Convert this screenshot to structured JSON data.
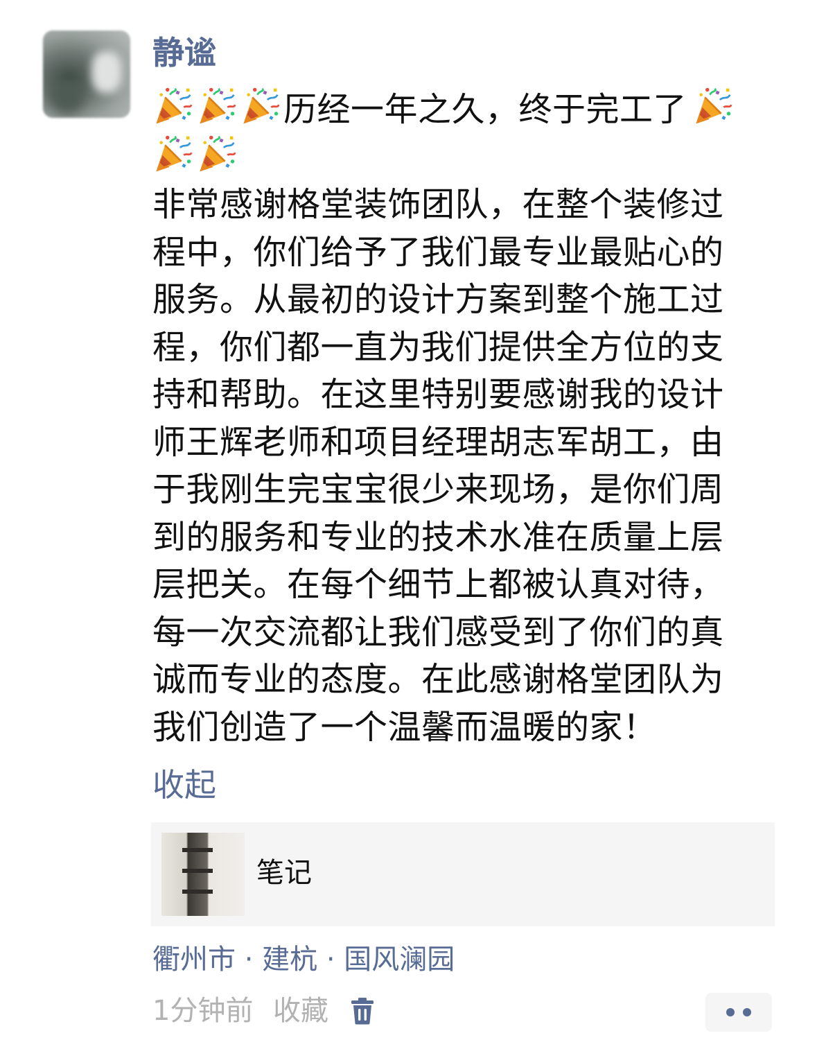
{
  "post": {
    "username": "静谧",
    "emoji_name": "party-popper-icon",
    "headline_text": "历经一年之久，终于完工了",
    "body_lines": [
      "非常感谢格堂装饰团队，在整个装修过",
      "程中，你们给予了我们最专业最贴心的",
      "服务。从最初的设计方案到整个施工过",
      "程，你们都一直为我们提供全方位的支",
      "持和帮助。在这里特别要感谢我的设计",
      "师王辉老师和项目经理胡志军胡工，由",
      "于我刚生完宝宝很少来现场，是你们周",
      "到的服务和专业的技术水准在质量上层",
      "层把关。在每个细节上都被认真对待，",
      "每一次交流都让我们感受到了你们的真",
      "诚而专业的态度。在此感谢格堂团队为",
      "我们创造了一个温馨而温暖的家！"
    ],
    "collapse_label": "收起"
  },
  "card": {
    "title": "笔记"
  },
  "location": "衢州市 · 建杭 · 国风澜园",
  "footer": {
    "time": "1分钟前",
    "favorite_label": "收藏"
  },
  "colors": {
    "link": "#576b95",
    "text": "#111111",
    "meta": "#b2b2b2",
    "card_bg": "#f5f5f5"
  }
}
